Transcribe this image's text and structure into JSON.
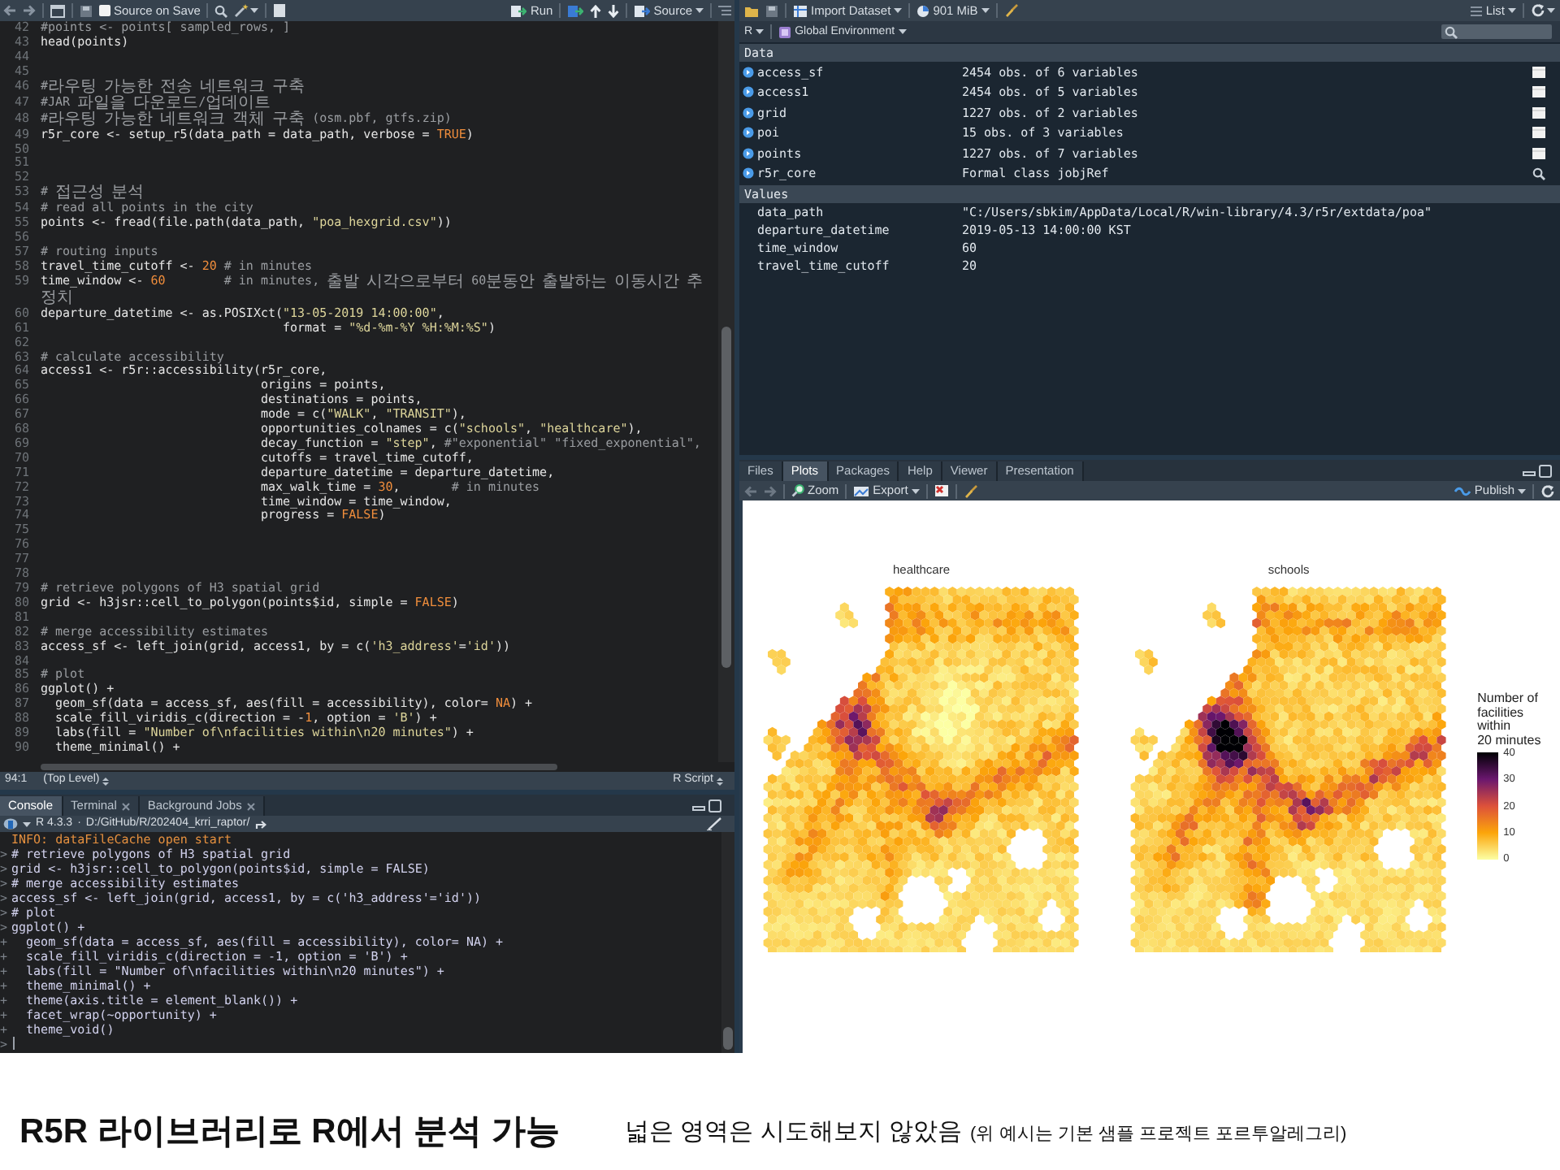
{
  "editor": {
    "toolbar": {
      "source_on_save": {
        "label": "Source on Save",
        "checked": false
      },
      "run": "Run",
      "source": "Source"
    },
    "lines": [
      {
        "number": "42",
        "tokens": [
          {
            "kind": "comment",
            "text": "#points <- points[ sampled_rows, ]"
          }
        ]
      },
      {
        "number": "43",
        "tokens": [
          {
            "kind": "plain",
            "text": "head(points)"
          }
        ]
      },
      {
        "number": "44"
      },
      {
        "number": "45"
      },
      {
        "number": "46",
        "tokens": [
          {
            "kind": "comment",
            "text": "#라우팅 가능한 전송 네트워크 구축"
          }
        ]
      },
      {
        "number": "47",
        "tokens": [
          {
            "kind": "comment",
            "text": "#JAR 파일을 다운로드/업데이트"
          }
        ]
      },
      {
        "number": "48",
        "tokens": [
          {
            "kind": "comment",
            "text": "#라우팅 가능한 네트워크 객체 구축 (osm.pbf, gtfs.zip)"
          }
        ]
      },
      {
        "number": "49",
        "tokens": [
          {
            "kind": "plain",
            "text": "r5r_core <- setup_r5(data_path = data_path, verbose = "
          },
          {
            "kind": "constant",
            "text": "TRUE"
          },
          {
            "kind": "plain",
            "text": ")"
          }
        ]
      },
      {
        "number": "50"
      },
      {
        "number": "51"
      },
      {
        "number": "52"
      },
      {
        "number": "53",
        "tokens": [
          {
            "kind": "comment",
            "text": "# 접근성 분석"
          }
        ]
      },
      {
        "number": "54",
        "tokens": [
          {
            "kind": "comment",
            "text": "# read all points in the city"
          }
        ]
      },
      {
        "number": "55",
        "tokens": [
          {
            "kind": "plain",
            "text": "points <- fread(file.path(data_path, "
          },
          {
            "kind": "string",
            "text": "\"poa_hexgrid.csv\""
          },
          {
            "kind": "plain",
            "text": "))"
          }
        ]
      },
      {
        "number": "56"
      },
      {
        "number": "57",
        "tokens": [
          {
            "kind": "comment",
            "text": "# routing inputs"
          }
        ]
      },
      {
        "number": "58",
        "tokens": [
          {
            "kind": "plain",
            "text": "travel_time_cutoff <- "
          },
          {
            "kind": "number",
            "text": "20"
          },
          {
            "kind": "comment",
            "text": " # in minutes"
          }
        ]
      },
      {
        "number": "59",
        "tokens": [
          {
            "kind": "plain",
            "text": "time_window <- "
          },
          {
            "kind": "number",
            "text": "60"
          },
          {
            "kind": "comment",
            "text": "        # in minutes, 출발 시각으로부터 60분동안 출발하는 이동시간 추정치"
          }
        ]
      },
      {
        "number": "60",
        "tokens": [
          {
            "kind": "plain",
            "text": "departure_datetime <- as.POSIXct("
          },
          {
            "kind": "string",
            "text": "\"13-05-2019 14:00:00\""
          },
          {
            "kind": "plain",
            "text": ","
          }
        ]
      },
      {
        "number": "61",
        "tokens": [
          {
            "kind": "plain",
            "text": "                                 format = "
          },
          {
            "kind": "string",
            "text": "\"%d-%m-%Y %H:%M:%S\""
          },
          {
            "kind": "plain",
            "text": ")"
          }
        ]
      },
      {
        "number": "62"
      },
      {
        "number": "63",
        "tokens": [
          {
            "kind": "comment",
            "text": "# calculate accessibility"
          }
        ]
      },
      {
        "number": "64",
        "tokens": [
          {
            "kind": "plain",
            "text": "access1 <- r5r::accessibility(r5r_core,"
          }
        ]
      },
      {
        "number": "65",
        "tokens": [
          {
            "kind": "plain",
            "text": "                              origins = points,"
          }
        ]
      },
      {
        "number": "66",
        "tokens": [
          {
            "kind": "plain",
            "text": "                              destinations = points,"
          }
        ]
      },
      {
        "number": "67",
        "tokens": [
          {
            "kind": "plain",
            "text": "                              mode = c("
          },
          {
            "kind": "string",
            "text": "\"WALK\""
          },
          {
            "kind": "plain",
            "text": ", "
          },
          {
            "kind": "string",
            "text": "\"TRANSIT\""
          },
          {
            "kind": "plain",
            "text": "),"
          }
        ]
      },
      {
        "number": "68",
        "tokens": [
          {
            "kind": "plain",
            "text": "                              opportunities_colnames = c("
          },
          {
            "kind": "string",
            "text": "\"schools\""
          },
          {
            "kind": "plain",
            "text": ", "
          },
          {
            "kind": "string",
            "text": "\"healthcare\""
          },
          {
            "kind": "plain",
            "text": "),"
          }
        ]
      },
      {
        "number": "69",
        "tokens": [
          {
            "kind": "plain",
            "text": "                              decay_function = "
          },
          {
            "kind": "string",
            "text": "\"step\""
          },
          {
            "kind": "plain",
            "text": ", "
          },
          {
            "kind": "comment",
            "text": "#\"exponential\" \"fixed_exponential\","
          }
        ]
      },
      {
        "number": "70",
        "tokens": [
          {
            "kind": "plain",
            "text": "                              cutoffs = travel_time_cutoff,"
          }
        ]
      },
      {
        "number": "71",
        "tokens": [
          {
            "kind": "plain",
            "text": "                              departure_datetime = departure_datetime,"
          }
        ]
      },
      {
        "number": "72",
        "tokens": [
          {
            "kind": "plain",
            "text": "                              max_walk_time = "
          },
          {
            "kind": "number",
            "text": "30"
          },
          {
            "kind": "plain",
            "text": ","
          },
          {
            "kind": "comment",
            "text": "       # in minutes"
          }
        ]
      },
      {
        "number": "73",
        "tokens": [
          {
            "kind": "plain",
            "text": "                              time_window = time_window,"
          }
        ]
      },
      {
        "number": "74",
        "tokens": [
          {
            "kind": "plain",
            "text": "                              progress = "
          },
          {
            "kind": "constant",
            "text": "FALSE"
          },
          {
            "kind": "plain",
            "text": ")"
          }
        ]
      },
      {
        "number": "75"
      },
      {
        "number": "76"
      },
      {
        "number": "77"
      },
      {
        "number": "78"
      },
      {
        "number": "79",
        "tokens": [
          {
            "kind": "comment",
            "text": "# retrieve polygons of H3 spatial grid"
          }
        ]
      },
      {
        "number": "80",
        "tokens": [
          {
            "kind": "plain",
            "text": "grid <- h3jsr::cell_to_polygon(points$id, simple = "
          },
          {
            "kind": "constant",
            "text": "FALSE"
          },
          {
            "kind": "plain",
            "text": ")"
          }
        ]
      },
      {
        "number": "81"
      },
      {
        "number": "82",
        "tokens": [
          {
            "kind": "comment",
            "text": "# merge accessibility estimates"
          }
        ]
      },
      {
        "number": "83",
        "tokens": [
          {
            "kind": "plain",
            "text": "access_sf <- left_join(grid, access1, by = c("
          },
          {
            "kind": "string",
            "text": "'h3_address'"
          },
          {
            "kind": "plain",
            "text": "="
          },
          {
            "kind": "string",
            "text": "'id'"
          },
          {
            "kind": "plain",
            "text": "))"
          }
        ]
      },
      {
        "number": "84"
      },
      {
        "number": "85",
        "tokens": [
          {
            "kind": "comment",
            "text": "# plot"
          }
        ]
      },
      {
        "number": "86",
        "tokens": [
          {
            "kind": "plain",
            "text": "ggplot() +"
          }
        ]
      },
      {
        "number": "87",
        "tokens": [
          {
            "kind": "plain",
            "text": "  geom_sf(data = access_sf, aes(fill = accessibility), color= "
          },
          {
            "kind": "constant",
            "text": "NA"
          },
          {
            "kind": "plain",
            "text": ") +"
          }
        ]
      },
      {
        "number": "88",
        "tokens": [
          {
            "kind": "plain",
            "text": "  scale_fill_viridis_c(direction = -"
          },
          {
            "kind": "number",
            "text": "1"
          },
          {
            "kind": "plain",
            "text": ", option = "
          },
          {
            "kind": "string",
            "text": "'B'"
          },
          {
            "kind": "plain",
            "text": ") +"
          }
        ]
      },
      {
        "number": "89",
        "tokens": [
          {
            "kind": "plain",
            "text": "  labs(fill = "
          },
          {
            "kind": "string",
            "text": "\"Number of\\nfacilities within\\n20 minutes\""
          },
          {
            "kind": "plain",
            "text": ") +"
          }
        ]
      },
      {
        "number": "90",
        "tokens": [
          {
            "kind": "plain",
            "text": "  theme_minimal() +"
          }
        ]
      }
    ],
    "status_bar": {
      "position": "94:1",
      "scope": "(Top Level)",
      "file_type": "R Script"
    }
  },
  "console": {
    "tabs": [
      {
        "label": "Console",
        "selected": true,
        "closable": false
      },
      {
        "label": "Terminal",
        "selected": false,
        "closable": true
      },
      {
        "label": "Background Jobs",
        "selected": false,
        "closable": true
      }
    ],
    "version": "R 4.3.3",
    "separator": "·",
    "path": "D:/GitHub/R/202404_krri_raptor/",
    "lines": [
      {
        "kind": "message",
        "text": "INFO: dataFileCache open start"
      },
      {
        "kind": "input",
        "prompt": ">",
        "text": "# retrieve polygons of H3 spatial grid"
      },
      {
        "kind": "input",
        "prompt": ">",
        "text": "grid <- h3jsr::cell_to_polygon(points$id, simple = FALSE)"
      },
      {
        "kind": "input",
        "prompt": ">",
        "text": "# merge accessibility estimates"
      },
      {
        "kind": "input",
        "prompt": ">",
        "text": "access_sf <- left_join(grid, access1, by = c('h3_address'='id'))"
      },
      {
        "kind": "input",
        "prompt": ">",
        "text": "# plot"
      },
      {
        "kind": "input",
        "prompt": ">",
        "text": "ggplot() +"
      },
      {
        "kind": "input",
        "prompt": "+",
        "text": "  geom_sf(data = access_sf, aes(fill = accessibility), color= NA) +"
      },
      {
        "kind": "input",
        "prompt": "+",
        "text": "  scale_fill_viridis_c(direction = -1, option = 'B') +"
      },
      {
        "kind": "input",
        "prompt": "+",
        "text": "  labs(fill = \"Number of\\nfacilities within\\n20 minutes\") +"
      },
      {
        "kind": "input",
        "prompt": "+",
        "text": "  theme_minimal() +"
      },
      {
        "kind": "input",
        "prompt": "+",
        "text": "  theme(axis.title = element_blank()) +"
      },
      {
        "kind": "input",
        "prompt": "+",
        "text": "  facet_wrap(~opportunity) +"
      },
      {
        "kind": "input",
        "prompt": "+",
        "text": "  theme_void()"
      },
      {
        "kind": "active",
        "prompt": ">"
      }
    ]
  },
  "environment": {
    "toolbar": {
      "import": "Import Dataset",
      "memory": "901 MiB",
      "view": "List"
    },
    "language": "R",
    "scope": "Global Environment",
    "sections": [
      {
        "kind": "data",
        "title": "Data",
        "rows": [
          {
            "name": "access_sf",
            "value": "2454 obs. of 6 variables",
            "kind": "dataframe"
          },
          {
            "name": "access1",
            "value": "2454 obs. of 5 variables",
            "kind": "dataframe"
          },
          {
            "name": "grid",
            "value": "1227 obs. of 2 variables",
            "kind": "dataframe"
          },
          {
            "name": "poi",
            "value": "15 obs. of 3 variables",
            "kind": "dataframe"
          },
          {
            "name": "points",
            "value": "1227 obs. of 7 variables",
            "kind": "dataframe"
          },
          {
            "name": "r5r_core",
            "value": "Formal class  jobjRef",
            "kind": "object"
          }
        ]
      },
      {
        "kind": "values",
        "title": "Values",
        "rows": [
          {
            "name": "data_path",
            "value": "\"C:/Users/sbkim/AppData/Local/R/win-library/4.3/r5r/extdata/poa\""
          },
          {
            "name": "departure_datetime",
            "value": "2019-05-13 14:00:00 KST"
          },
          {
            "name": "time_window",
            "value": "60"
          },
          {
            "name": "travel_time_cutoff",
            "value": "20"
          }
        ]
      }
    ]
  },
  "plots_pane": {
    "tabs": [
      {
        "label": "Files",
        "selected": false
      },
      {
        "label": "Plots",
        "selected": true
      },
      {
        "label": "Packages",
        "selected": false
      },
      {
        "label": "Help",
        "selected": false
      },
      {
        "label": "Viewer",
        "selected": false
      },
      {
        "label": "Presentation",
        "selected": false
      }
    ],
    "toolbar": {
      "zoom": "Zoom",
      "export": "Export",
      "publish": "Publish"
    },
    "plot": {
      "facets": [
        {
          "title": "healthcare"
        },
        {
          "title": "schools"
        }
      ],
      "legend": {
        "title": "Number of\nfacilities within\n20 minutes",
        "ticks": [
          "40",
          "30",
          "20",
          "10",
          "0"
        ]
      }
    }
  },
  "caption": {
    "headline": "R5R 라이브러리로 R에서 분석 가능",
    "note": "넓은 영역은 시도해보지 않았음",
    "aside": "(위 예시는 기본 샘플 프로젝트 포르투알레그리)"
  }
}
